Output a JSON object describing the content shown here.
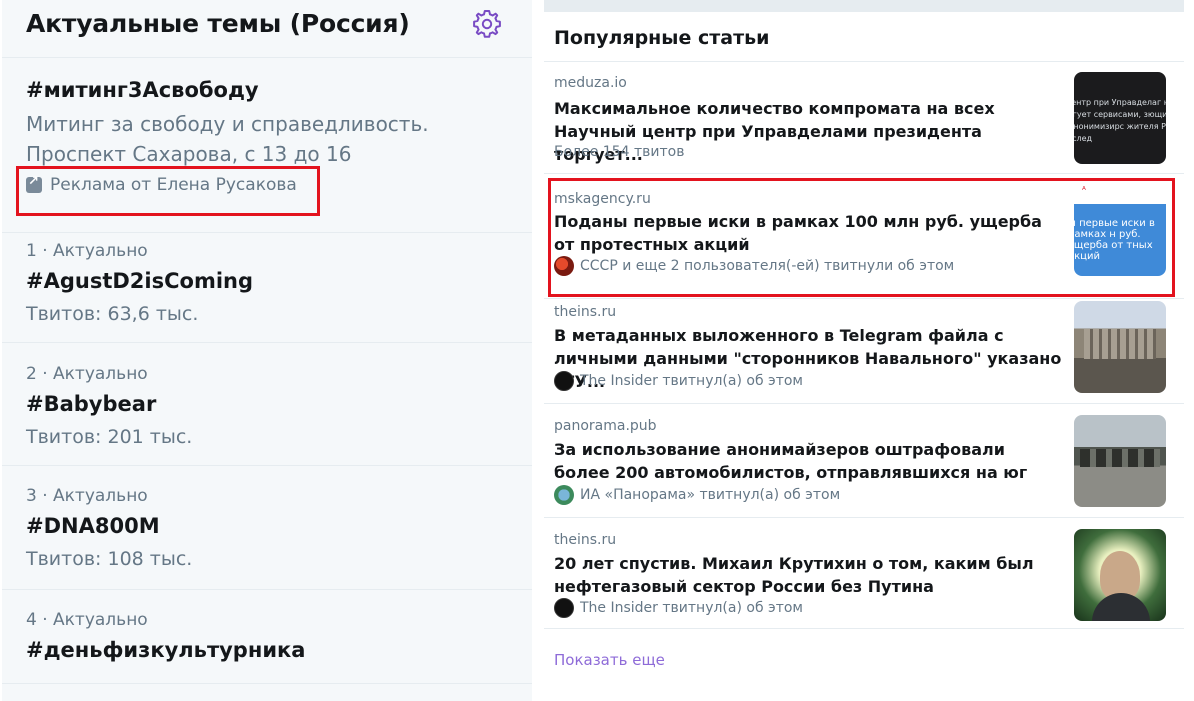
{
  "left": {
    "title": "Актуальные темы (Россия)",
    "promo": {
      "hashtag": "#митинг3Асвободу",
      "desc_line1": "Митинг за свободу и справедливость.",
      "desc_line2": "Проспект Сахарова, с 13 до 16",
      "ad_text": "Реклама от Елена Русакова"
    },
    "trends": [
      {
        "meta": "1 · Актуально",
        "name": "#AgustD2isComing",
        "count": "Твитов: 63,6 тыс."
      },
      {
        "meta": "2 · Актуально",
        "name": "#Babybear",
        "count": "Твитов: 201 тыс."
      },
      {
        "meta": "3 · Актуально",
        "name": "#DNA800M",
        "count": "Твитов: 108 тыс."
      },
      {
        "meta": "4 · Актуально",
        "name": "#деньфизкультурника",
        "count": ""
      }
    ]
  },
  "right": {
    "title": "Популярные статьи",
    "articles": [
      {
        "source": "meduza.io",
        "title": "Максимальное количество компромата на всех Научный центр при Управделами президента торгует...",
        "byline": "Более 154 твитов",
        "thumb_text": "й центр при Управделаг нта торгует сервисами, зющими деанонимизирс жителя России. Расслед"
      },
      {
        "source": "mskagency.ru",
        "title": "Поданы первые иски в рамках 100 млн руб. ущерба от протестных акций",
        "byline": "СССР и еще 2 пользователя(-ей) твитнули об этом",
        "thumb_text": "ы первые иски в рамках н руб. ущерба от тных акций"
      },
      {
        "source": "theins.ru",
        "title": "В метаданных выложенного в Telegram файла с личными данными \"сторонников Навального\" указано «ГУ...",
        "byline": "The Insider твитнул(а) об этом"
      },
      {
        "source": "panorama.pub",
        "title": "За использование анонимайзеров оштрафовали более 200 автомобилистов, отправлявшихся на юг",
        "byline": "ИА «Панорама» твитнул(а) об этом"
      },
      {
        "source": "theins.ru",
        "title": "20 лет спустив. Михаил Крутихин о том, каким был нефтегазовый сектор России без Путина",
        "byline": "The Insider твитнул(а) об этом"
      }
    ],
    "show_more": "Показать еще"
  },
  "colors": {
    "accent": "#794bc4",
    "highlight_border": "#e3131e",
    "secondary_text": "#657786"
  }
}
